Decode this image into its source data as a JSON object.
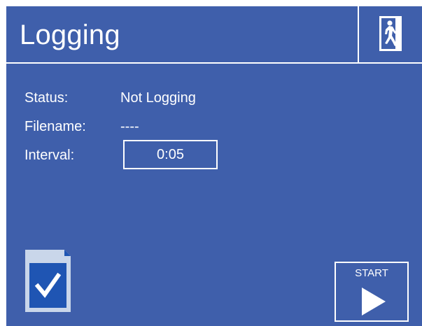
{
  "header": {
    "title": "Logging"
  },
  "exit_button": {
    "icon": "exit-running-man-icon"
  },
  "fields": {
    "status": {
      "label": "Status:",
      "value": "Not Logging"
    },
    "filename": {
      "label": "Filename:",
      "value": "----"
    },
    "interval": {
      "label": "Interval:",
      "value": "0:05"
    }
  },
  "sd_card": {
    "icon": "sd-card-check-icon",
    "status": "ready"
  },
  "start_button": {
    "label": "START",
    "icon": "play-icon"
  },
  "colors": {
    "background": "#3f5fab",
    "foreground": "#ffffff",
    "sd_card_accent": "#1f55b3"
  }
}
